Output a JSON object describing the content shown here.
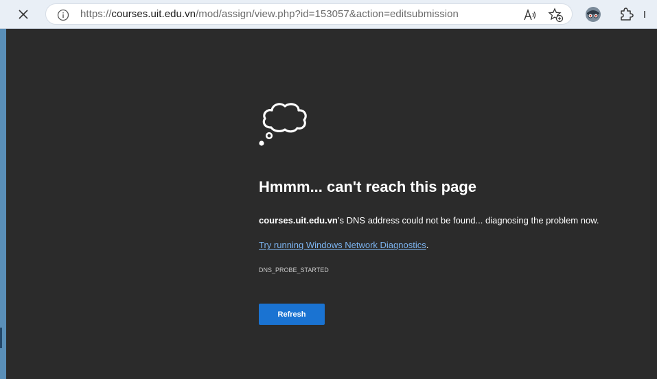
{
  "browser": {
    "url_prefix": "https://",
    "url_host": "courses.uit.edu.vn",
    "url_rest": "/mod/assign/view.php?id=153057&action=editsubmission",
    "icons": {
      "stop": "close-icon",
      "info": "info-icon",
      "read_aloud": "read-aloud-icon",
      "favorite": "add-favorite-icon",
      "profile": "profile-icon",
      "extensions": "extensions-icon",
      "more": "chevron-icon"
    }
  },
  "error_page": {
    "headline": "Hmmm... can't reach this page",
    "host": "courses.uit.edu.vn",
    "message_rest": "’s DNS address could not be found... diagnosing the problem now.",
    "diag_link": "Try running Windows Network Diagnostics",
    "diag_suffix": ".",
    "error_code": "DNS_PROBE_STARTED",
    "refresh_label": "Refresh",
    "icon": "cloud-icon"
  },
  "colors": {
    "toolbar_bg": "#e9eff6",
    "page_bg": "#2b2b2b",
    "link": "#7cb4f0",
    "button": "#1a73d2"
  }
}
